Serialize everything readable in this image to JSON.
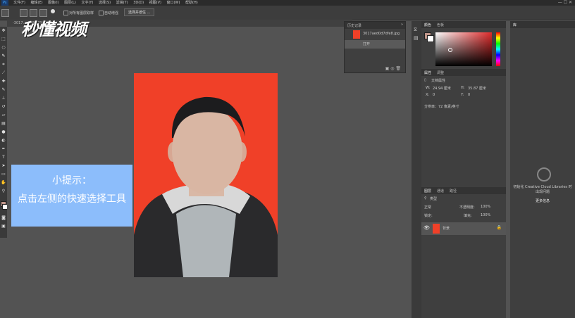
{
  "menubar": {
    "ps_icon": "Ps",
    "items": [
      "文件(F)",
      "编辑(E)",
      "图像(I)",
      "图层(L)",
      "文字(Y)",
      "选择(S)",
      "滤镜(T)",
      "3D(D)",
      "视图(V)",
      "窗口(W)",
      "帮助(H)"
    ],
    "controls": "—  ☐  ✕"
  },
  "options": {
    "sample_all_layers": "对所有图层取样",
    "auto_enhance": "自动增强",
    "select_and_mask": "选择并遮住 ..."
  },
  "doc_tab": {
    "title": "-3017... @ 66.7%(RGB/8)"
  },
  "watermark": {
    "logo": "秒懂视频"
  },
  "hint": {
    "title": "小提示：",
    "text": "点击左侧的快速选择工具"
  },
  "history": {
    "tab": "历史记录",
    "snapshot": "3017aed0d7dfe8.jpg",
    "step": "打开"
  },
  "color": {
    "tab1": "颜色",
    "tab2": "色板",
    "fg": "#c0968a",
    "bg": "#ffffff"
  },
  "properties": {
    "tab1": "属性",
    "tab2": "调整",
    "doc_props": "文档属性",
    "w_label": "W:",
    "w_value": "24.94 厘米",
    "h_label": "H:",
    "h_value": "35.87 厘米",
    "x_label": "X:",
    "x_value": "0",
    "y_label": "Y:",
    "y_value": "0",
    "resolution": "分辨率：72 像素/英寸"
  },
  "layers": {
    "tab1": "图层",
    "tab2": "通道",
    "tab3": "路径",
    "kind": "类型",
    "blend": "正常",
    "opacity_label": "不透明度:",
    "opacity": "100%",
    "lock_label": "锁定:",
    "fill_label": "填充:",
    "fill": "100%",
    "layer_name": "背景"
  },
  "libraries": {
    "tab": "库",
    "init_text": "初始化 Creative Cloud Libraries 时出现问题",
    "more_info": "更多信息"
  },
  "colors": {
    "photo_bg": "#f04028",
    "hint_bg": "#8cbdfb",
    "panel_bg": "#3f3f3f",
    "canvas_bg": "#535353"
  }
}
